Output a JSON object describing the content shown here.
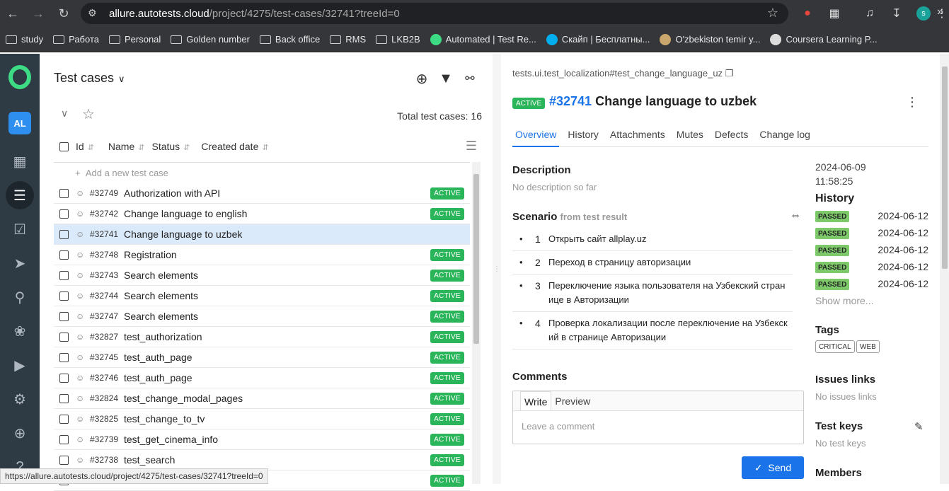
{
  "browser": {
    "url_host": "allure.autotests.cloud",
    "url_path": "/project/4275/test-cases/32741?treeId=0",
    "profile_initial": "s",
    "bookmarks": [
      {
        "label": "study",
        "type": "folder"
      },
      {
        "label": "Работа",
        "type": "folder"
      },
      {
        "label": "Personal",
        "type": "folder"
      },
      {
        "label": "Golden number",
        "type": "folder"
      },
      {
        "label": "Back office",
        "type": "folder"
      },
      {
        "label": "RMS",
        "type": "folder"
      },
      {
        "label": "LKB2B",
        "type": "folder"
      },
      {
        "label": "Automated | Test Re...",
        "type": "site",
        "color": "#3ddc84"
      },
      {
        "label": "Скайп | Бесплатны...",
        "type": "site",
        "color": "#00aff0"
      },
      {
        "label": "O'zbekiston temir y...",
        "type": "site",
        "color": "#c9a66b"
      },
      {
        "label": "Coursera Learning P...",
        "type": "site",
        "color": "#dddddd"
      }
    ],
    "status_url": "https://allure.autotests.cloud/project/4275/test-cases/32741?treeId=0"
  },
  "sidebar": {
    "avatar": "AL",
    "icons": [
      "dashboard-icon",
      "test-cases-icon",
      "test-plans-icon",
      "launches-icon",
      "analytics-icon",
      "defects-icon",
      "jobs-icon",
      "settings-icon",
      "add-icon",
      "help-icon"
    ]
  },
  "list": {
    "title": "Test cases",
    "total_label": "Total test cases: 16",
    "columns": {
      "id": "Id",
      "name": "Name",
      "status": "Status",
      "created": "Created date"
    },
    "add_label": "Add a new test case",
    "rows": [
      {
        "id": "#32749",
        "name": "Authorization with API",
        "status": "ACTIVE"
      },
      {
        "id": "#32742",
        "name": "Change language to english",
        "status": "ACTIVE"
      },
      {
        "id": "#32741",
        "name": "Change language to uzbek",
        "status": "",
        "selected": true
      },
      {
        "id": "#32748",
        "name": "Registration",
        "status": "ACTIVE"
      },
      {
        "id": "#32743",
        "name": "Search elements",
        "status": "ACTIVE"
      },
      {
        "id": "#32744",
        "name": "Search elements",
        "status": "ACTIVE"
      },
      {
        "id": "#32747",
        "name": "Search elements",
        "status": "ACTIVE"
      },
      {
        "id": "#32827",
        "name": "test_authorization",
        "status": "ACTIVE"
      },
      {
        "id": "#32745",
        "name": "test_auth_page",
        "status": "ACTIVE"
      },
      {
        "id": "#32746",
        "name": "test_auth_page",
        "status": "ACTIVE"
      },
      {
        "id": "#32824",
        "name": "test_change_modal_pages",
        "status": "ACTIVE"
      },
      {
        "id": "#32825",
        "name": "test_change_to_tv",
        "status": "ACTIVE"
      },
      {
        "id": "#32739",
        "name": "test_get_cinema_info",
        "status": "ACTIVE"
      },
      {
        "id": "#32738",
        "name": "test_search",
        "status": "ACTIVE"
      },
      {
        "id": "",
        "name": "",
        "status": "ACTIVE"
      }
    ]
  },
  "detail": {
    "fqn": "tests.ui.test_localization#test_change_language_uz",
    "status": "ACTIVE",
    "number": "#32741",
    "title": "Change language to uzbek",
    "tabs": [
      "Overview",
      "History",
      "Attachments",
      "Mutes",
      "Defects",
      "Change log"
    ],
    "description_h": "Description",
    "description_v": "No description so far",
    "scenario_h": "Scenario",
    "scenario_from": "from test result",
    "steps": [
      {
        "n": "1",
        "text": "Открыть сайт allplay.uz"
      },
      {
        "n": "2",
        "text": "Переход в страницу авторизации"
      },
      {
        "n": "3",
        "text": "Переключение языка пользователя на Узбекский стран ице в Авторизации"
      },
      {
        "n": "4",
        "text": "Проверка локализации после переключение на Узбекск ий в странице Авторизации"
      }
    ],
    "comments_h": "Comments",
    "comment_tabs": [
      "Write",
      "Preview"
    ],
    "comment_placeholder": "Leave a comment",
    "send": "Send",
    "created_date": "2024-06-09",
    "created_time": "11:58:25",
    "history_h": "History",
    "history": [
      {
        "status": "PASSED",
        "date": "2024-06-12"
      },
      {
        "status": "PASSED",
        "date": "2024-06-12"
      },
      {
        "status": "PASSED",
        "date": "2024-06-12"
      },
      {
        "status": "PASSED",
        "date": "2024-06-12"
      },
      {
        "status": "PASSED",
        "date": "2024-06-12"
      }
    ],
    "show_more": "Show more...",
    "tags_h": "Tags",
    "tags": [
      "CRITICAL",
      "WEB"
    ],
    "issues_h": "Issues links",
    "issues_v": "No issues links",
    "keys_h": "Test keys",
    "keys_v": "No test keys",
    "members_h": "Members"
  }
}
